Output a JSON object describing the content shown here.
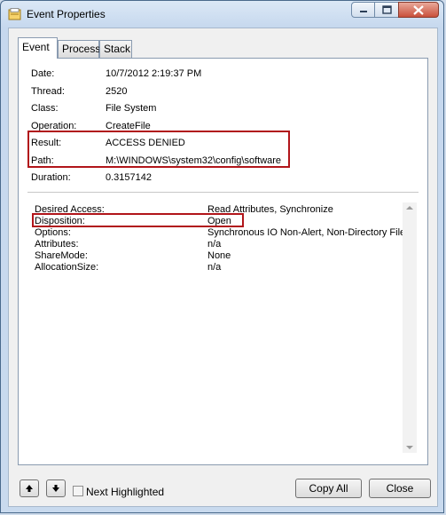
{
  "window": {
    "title": "Event Properties"
  },
  "tabs": [
    {
      "label": "Event"
    },
    {
      "label": "Process"
    },
    {
      "label": "Stack"
    }
  ],
  "event": {
    "date": {
      "label": "Date:",
      "value": "10/7/2012 2:19:37 PM"
    },
    "thread": {
      "label": "Thread:",
      "value": "2520"
    },
    "class": {
      "label": "Class:",
      "value": "File System"
    },
    "operation": {
      "label": "Operation:",
      "value": "CreateFile"
    },
    "result": {
      "label": "Result:",
      "value": "ACCESS DENIED"
    },
    "path": {
      "label": "Path:",
      "value": "M:\\WINDOWS\\system32\\config\\software"
    },
    "duration": {
      "label": "Duration:",
      "value": "0.3157142"
    }
  },
  "details": [
    {
      "key": "Desired Access:",
      "value": "Read Attributes, Synchronize"
    },
    {
      "key": "Disposition:",
      "value": "Open"
    },
    {
      "key": "Options:",
      "value": "Synchronous IO Non-Alert, Non-Directory File"
    },
    {
      "key": "Attributes:",
      "value": "n/a"
    },
    {
      "key": "ShareMode:",
      "value": "None"
    },
    {
      "key": "AllocationSize:",
      "value": "n/a"
    }
  ],
  "footer": {
    "next_highlighted_label": "Next Highlighted",
    "copy_all_label": "Copy All",
    "close_label": "Close"
  },
  "colors": {
    "highlight_box": "#b1151a"
  }
}
